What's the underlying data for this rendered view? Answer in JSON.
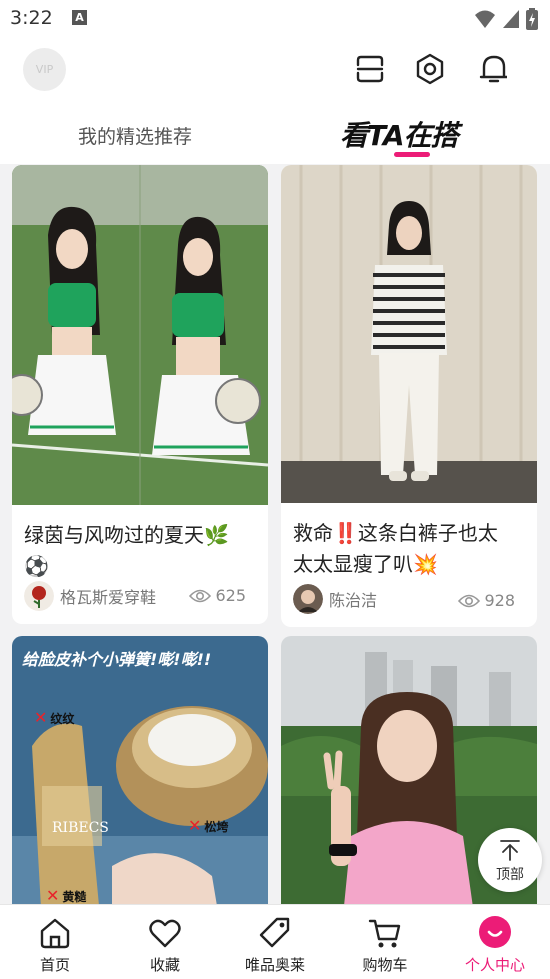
{
  "status_bar": {
    "time": "3:22",
    "notif_letter": "A"
  },
  "header": {
    "vip_label": "VIP",
    "tabs": [
      {
        "label": "我的精选推荐",
        "active": false
      },
      {
        "label": "看TA在搭",
        "active": true
      }
    ]
  },
  "accent_color": "#ec1c77",
  "cards": [
    {
      "title_line1": "绿茵与风吻过的夏天🌿",
      "title_line2": "⚽",
      "author": "格瓦斯爱穿鞋",
      "views": "625"
    },
    {
      "title_line1": "救命‼️这条白裤子也太",
      "title_line2": "太太显瘦了叭💥",
      "author": "陈治洁",
      "views": "928"
    },
    {
      "overlay_title": "给脸皮补个小弹簧!嘭!嘭!!",
      "labels": [
        "纹纹",
        "松垮",
        "黄糙"
      ],
      "brand": "RIBECS"
    },
    {}
  ],
  "back_to_top": "顶部",
  "bottom_nav": [
    {
      "label": "首页",
      "icon": "home-icon"
    },
    {
      "label": "收藏",
      "icon": "heart-icon"
    },
    {
      "label": "唯品奥莱",
      "icon": "tag-icon"
    },
    {
      "label": "购物车",
      "icon": "cart-icon"
    },
    {
      "label": "个人中心",
      "icon": "profile-icon",
      "active": true
    }
  ]
}
